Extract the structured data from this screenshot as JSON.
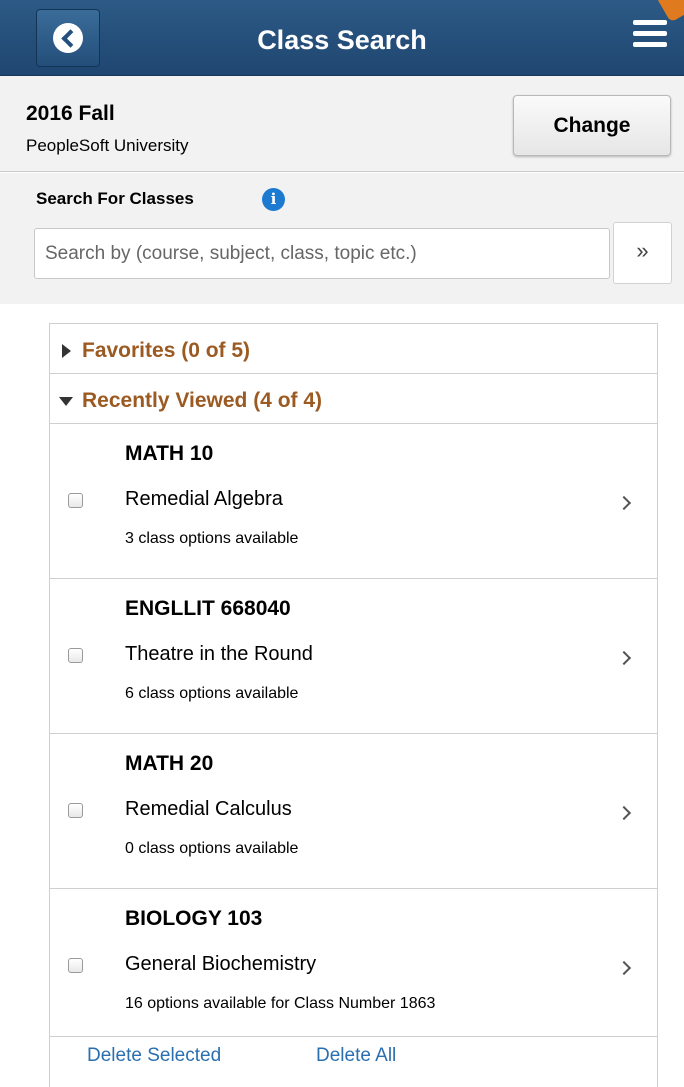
{
  "header": {
    "title": "Class Search"
  },
  "term": {
    "name": "2016 Fall",
    "institution": "PeopleSoft University",
    "change_label": "Change"
  },
  "search": {
    "label": "Search For Classes",
    "placeholder": "Search by (course, subject, class, topic etc.)",
    "go_label": "»"
  },
  "favorites": {
    "label": "Favorites (0 of 5)",
    "expanded": false
  },
  "recently_viewed": {
    "label": "Recently Viewed (4 of 4)",
    "expanded": true,
    "items": [
      {
        "code": "MATH 10",
        "title": "Remedial Algebra",
        "availability": "3 class options available",
        "checked": false
      },
      {
        "code": "ENGLLIT 668040",
        "title": "Theatre in the Round",
        "availability": "6 class options available",
        "checked": false
      },
      {
        "code": "MATH 20",
        "title": "Remedial Calculus",
        "availability": "0 class options available",
        "checked": false
      },
      {
        "code": "BIOLOGY 103",
        "title": "General Biochemistry",
        "availability": "16 options available for Class Number 1863",
        "checked": false
      }
    ]
  },
  "actions": {
    "delete_selected": "Delete Selected",
    "delete_all": "Delete All"
  },
  "colors": {
    "header_bg": "#1f4670",
    "group_header_text": "#9b5a21",
    "link": "#2a6fb0"
  }
}
